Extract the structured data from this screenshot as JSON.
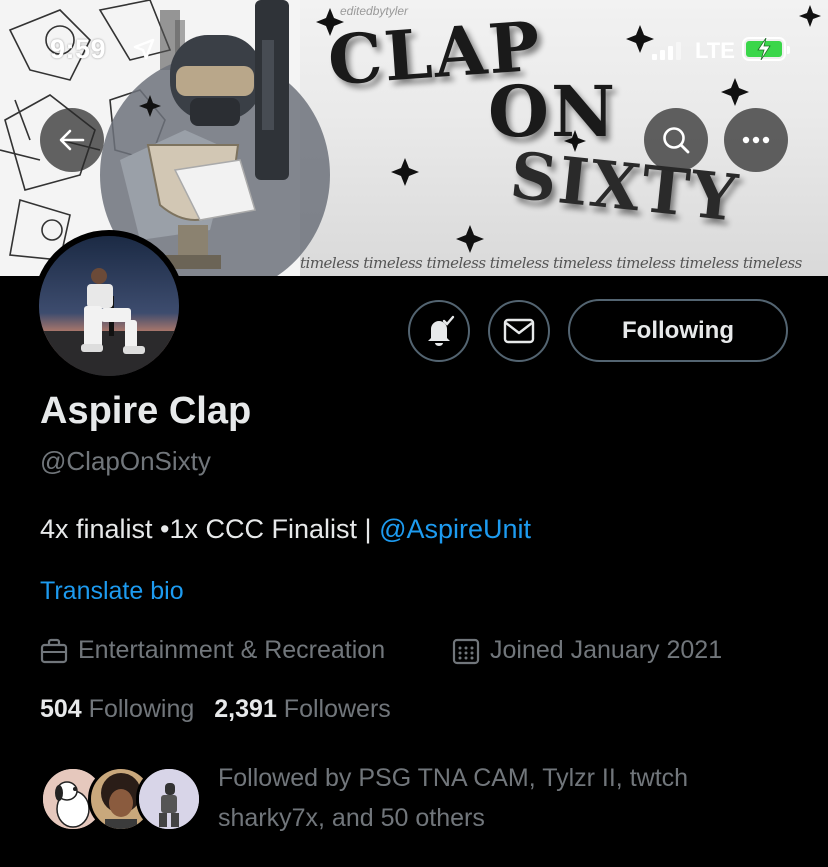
{
  "status_bar": {
    "time": "9:59",
    "network": "LTE",
    "icons": [
      "location-arrow-icon",
      "signal-icon",
      "battery-charging-icon"
    ]
  },
  "banner": {
    "headline_line1": "CLAP",
    "headline_line2": "ON",
    "headline_line3": "SIXTY",
    "credit": "editedbytyler",
    "strip_text": "timeless timeless timeless timeless timeless timeless timeless timeless"
  },
  "nav": {
    "back_icon": "arrow-left-icon",
    "search_icon": "search-icon",
    "more_icon": "more-horizontal-icon"
  },
  "actions": {
    "notify_icon": "bell-check-icon",
    "message_icon": "envelope-icon",
    "following_label": "Following"
  },
  "profile": {
    "name": "Aspire Clap",
    "handle": "@ClapOnSixty",
    "bio_text": "4x finalist •1x CCC Finalist | ",
    "bio_mention": "@AspireUnit",
    "translate_label": "Translate bio",
    "category": "Entertainment & Recreation",
    "joined": "Joined January 2021"
  },
  "stats": {
    "following_count": "504",
    "following_label": "Following",
    "followers_count": "2,391",
    "followers_label": "Followers"
  },
  "followed_by": {
    "text": "Followed by PSG TNA CAM, Tylzr II, twtch sharky7x, and 50 others"
  },
  "colors": {
    "background": "#000000",
    "accent": "#1d9bf0",
    "secondary_text": "#71767b",
    "primary_text": "#e7e9ea",
    "border": "#536471"
  }
}
